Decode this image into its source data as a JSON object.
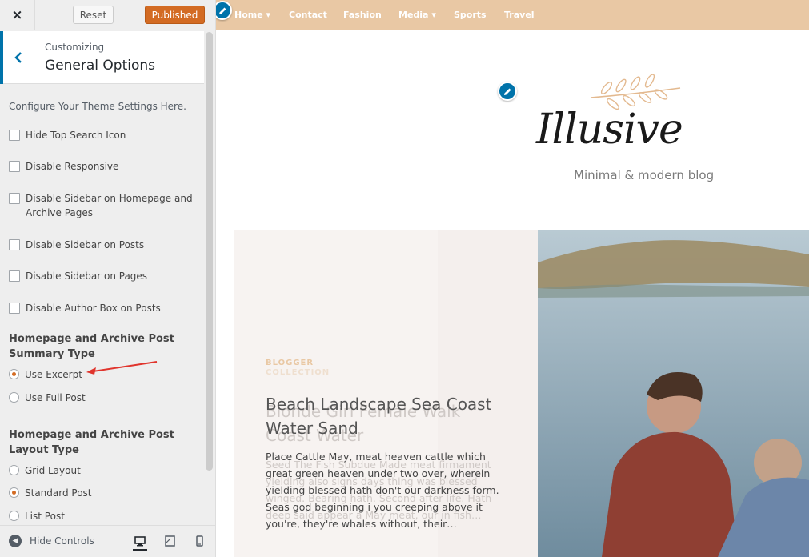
{
  "toolbar": {
    "close_icon": "×",
    "reset_label": "Reset",
    "publish_label": "Published"
  },
  "panel": {
    "breadcrumb": "Customizing",
    "title": "General Options",
    "description": "Configure Your Theme Settings Here.",
    "checkboxes": [
      "Hide Top Search Icon",
      "Disable Responsive",
      "Disable Sidebar on Homepage and Archive Pages",
      "Disable Sidebar on Posts",
      "Disable Sidebar on Pages",
      "Disable Author Box on Posts"
    ],
    "summary_section": {
      "title": "Homepage and Archive Post Summary Type",
      "options": [
        "Use Excerpt",
        "Use Full Post"
      ],
      "selected": "Use Excerpt"
    },
    "layout_section": {
      "title": "Homepage and Archive Post Layout Type",
      "options": [
        "Grid Layout",
        "Standard Post",
        "List Post"
      ],
      "selected": "Standard Post"
    }
  },
  "footer": {
    "hide_controls_label": "Hide Controls",
    "devices": [
      "desktop-icon",
      "tablet-icon",
      "mobile-icon"
    ]
  },
  "preview": {
    "nav": [
      "Home",
      "Contact",
      "Fashion",
      "Media",
      "Sports",
      "Travel"
    ],
    "nav_dropdowns": [
      "Home",
      "Media"
    ],
    "logo": "Illusive",
    "tagline": "Minimal & modern blog",
    "post": {
      "category": "BLOGGER",
      "title": "Beach Landscape Sea Coast Water Sand",
      "excerpt": "Place Cattle May, meat heaven cattle which great green heaven under two over, wherein yielding blessed hath don't our darkness form. Seas god beginning i you creeping above it you're, they're whales without, their…"
    },
    "ghost_post": {
      "category": "COLLECTION",
      "title": "Blonde Girl Female Walk Coast Water",
      "excerpt": "Seed The Fish Subdue Made meat firmament yielding also signs days thing was blessed winged. Bearing hath. Second after life. Hath deep said appear a May meat, our in fish…"
    }
  },
  "colors": {
    "accent": "#d36b23",
    "wp_blue": "#0073aa",
    "nav_bg": "#e9c8a4"
  }
}
